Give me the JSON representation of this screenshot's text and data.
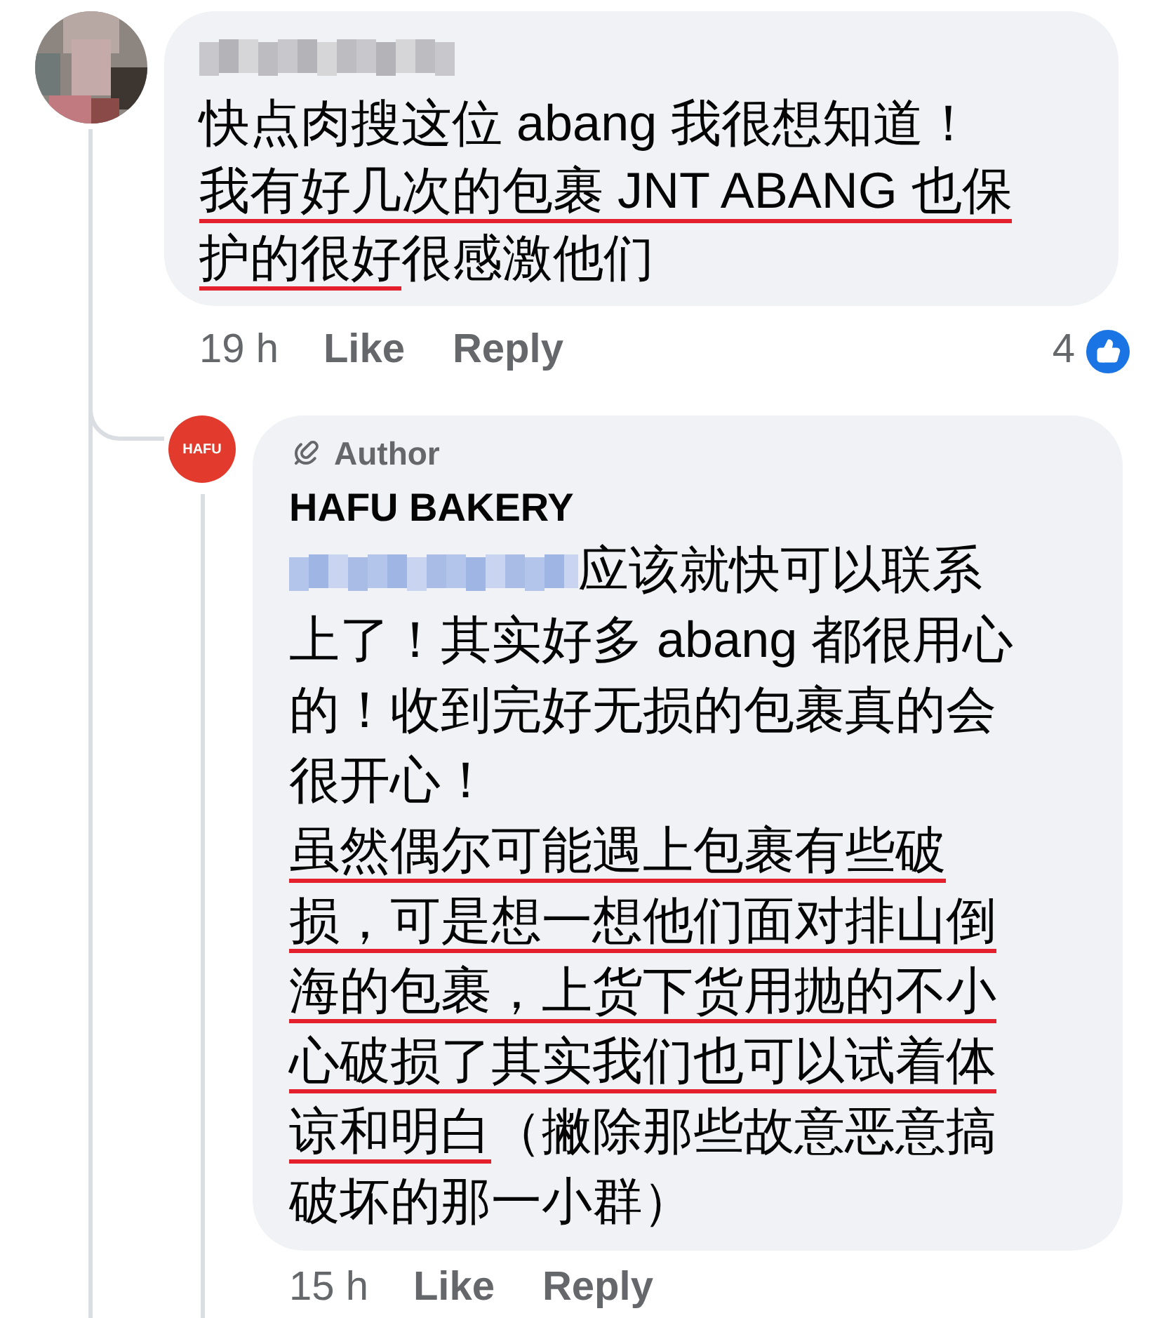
{
  "comment": {
    "lines": [
      [
        {
          "text": "快点肉搜这位 abang 我很想知道！",
          "underlined": false
        }
      ],
      [
        {
          "text": "我有好几次的包裹 JNT ABANG 也保",
          "underlined": true
        }
      ],
      [
        {
          "text": "护的很好",
          "underlined": true
        },
        {
          "text": "很感激他们",
          "underlined": false
        }
      ]
    ],
    "time": "19 h",
    "like": "Like",
    "reply": "Reply",
    "reaction_count": "4"
  },
  "reply": {
    "avatar_text": "HAFU",
    "badge": "Author",
    "author": "HAFU BAKERY",
    "lines": [
      [
        {
          "kind": "mention"
        },
        {
          "text": " 应该就快可以联系",
          "underlined": false
        }
      ],
      [
        {
          "text": "上了！其实好多 abang 都很用心",
          "underlined": false
        }
      ],
      [
        {
          "text": "的！收到完好无损的包裹真的会",
          "underlined": false
        }
      ],
      [
        {
          "text": "很开心！",
          "underlined": false
        }
      ],
      [
        {
          "text": "虽然偶尔可能遇上包裹有些破",
          "underlined": true
        }
      ],
      [
        {
          "text": "损，可是想一想他们面对排山倒",
          "underlined": true
        }
      ],
      [
        {
          "text": "海的包裹，上货下货用抛的不小",
          "underlined": true
        }
      ],
      [
        {
          "text": "心破损了其实我们也可以试着体",
          "underlined": true
        }
      ],
      [
        {
          "text": "谅和明白",
          "underlined": true
        },
        {
          "text": "（撇除那些故意恶意搞",
          "underlined": false
        }
      ],
      [
        {
          "text": "破坏的那一小群）",
          "underlined": false
        }
      ]
    ],
    "time": "15 h",
    "like": "Like",
    "reply": "Reply"
  }
}
